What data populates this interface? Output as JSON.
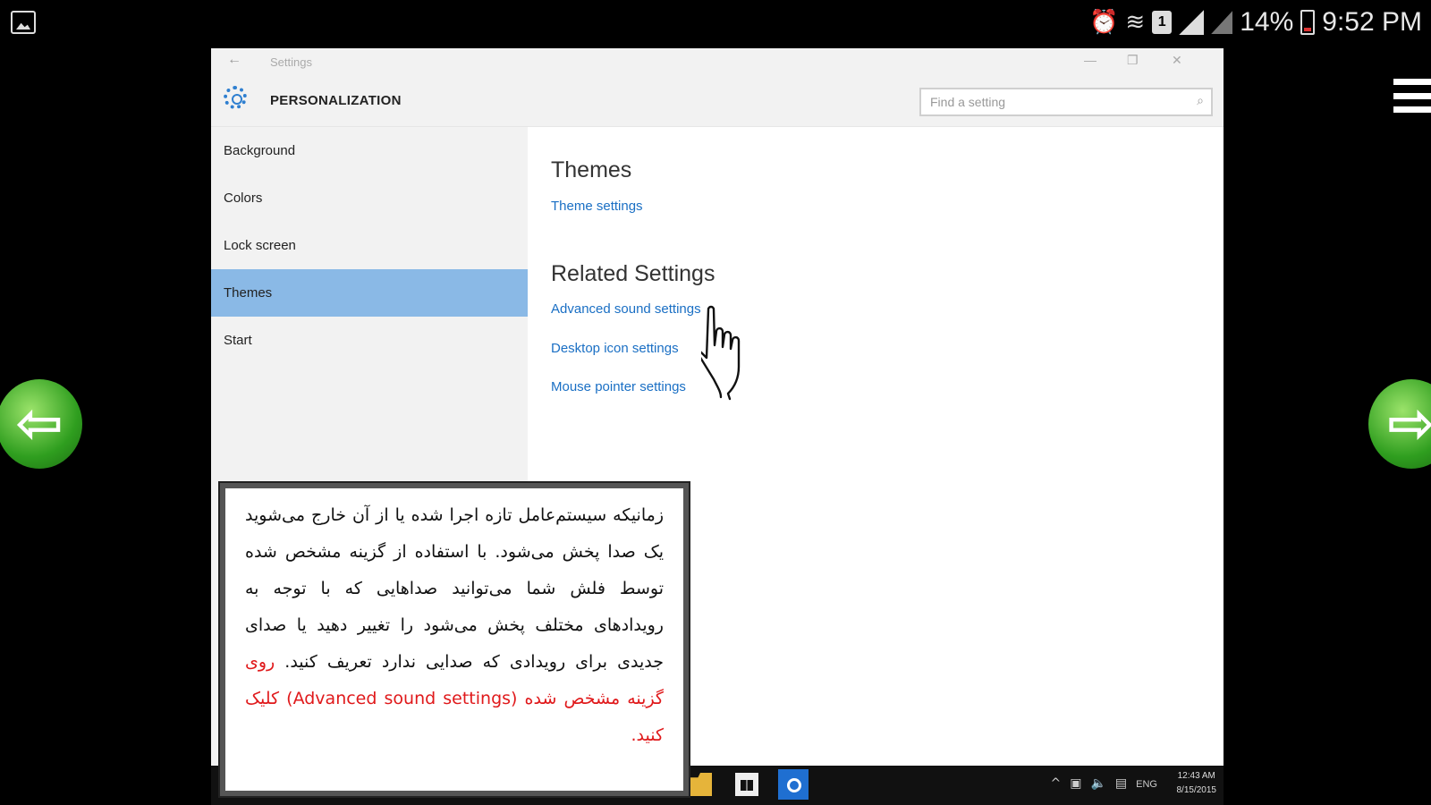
{
  "statusbar": {
    "battery_pct": "14%",
    "time": "9:52 PM",
    "sim_label": "1",
    "icons": [
      "gallery-icon",
      "alarm-icon",
      "wifi-icon",
      "sim-icon",
      "signal-icon",
      "battery-icon",
      "menu-icon"
    ]
  },
  "window": {
    "title": "Settings",
    "category": "PERSONALIZATION",
    "search_placeholder": "Find a setting",
    "sidebar_items": [
      "Background",
      "Colors",
      "Lock screen",
      "Themes",
      "Start"
    ],
    "selected_item": "Themes",
    "section_title": "Themes",
    "theme_link": "Theme settings",
    "related_title": "Related Settings",
    "related_links": [
      "Advanced sound settings",
      "Desktop icon settings",
      "Mouse pointer settings"
    ]
  },
  "taskbar": {
    "language": "ENG",
    "clock_time": "12:43 AM",
    "clock_date": "8/15/2015"
  },
  "note": {
    "text": "زمانیکه سیستم‌عامل تازه اجرا شده یا از آن خارج می‌شوید یک صدا پخش می‌شود. با استفاده از گزینه مشخص شده توسط فلش شما می‌توانید صداهایی که با توجه به رویدادهای مختلف پخش می‌شود را تغییر دهید یا صدای جدیدی برای رویدادی که صدایی ندارد تعریف کنید.",
    "highlight": "روی گزینه مشخص شده (Advanced sound settings) کلیک کنید."
  },
  "colors": {
    "accent": "#1a6fc4",
    "selection": "#8ab9e6",
    "note_highlight": "#e0191b",
    "nav_arrow": "#2f9e1f"
  }
}
